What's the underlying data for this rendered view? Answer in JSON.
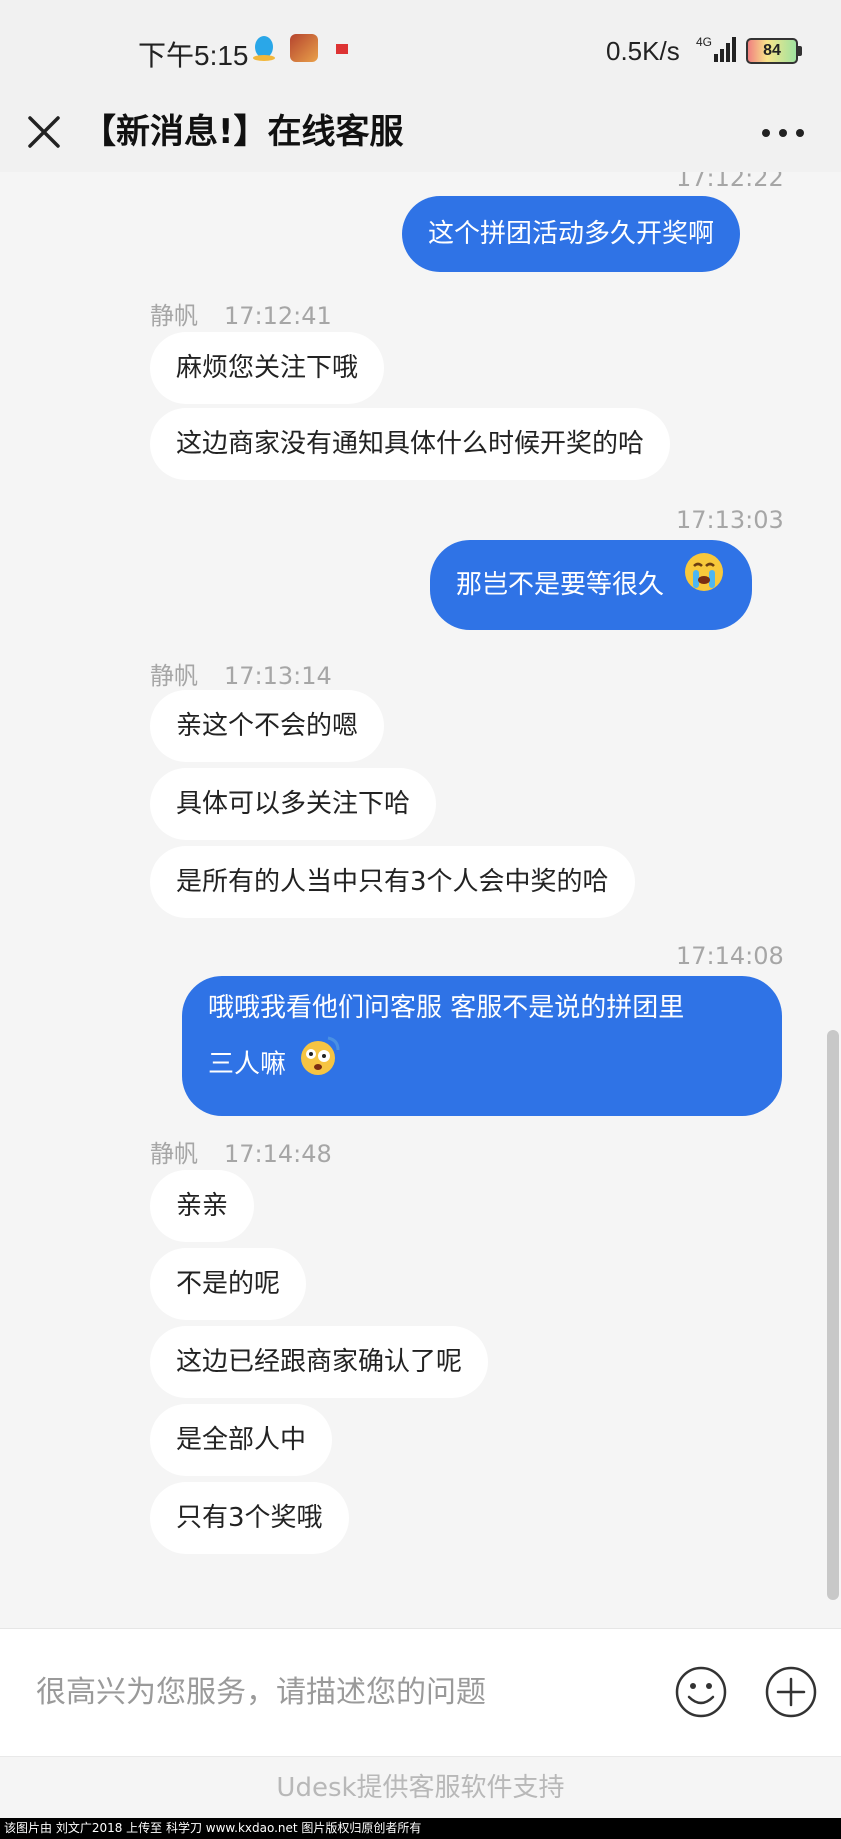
{
  "status_bar": {
    "time": "下午5:15",
    "network_speed": "0.5K/s",
    "network_type": "4G",
    "battery": "84"
  },
  "header": {
    "title": "【新消息!】在线客服",
    "close_icon": "close-icon",
    "more_icon": "more-icon"
  },
  "colors": {
    "outgoing_bubble": "#2f73e6",
    "incoming_bubble": "#ffffff",
    "background": "#f5f5f5"
  },
  "messages": {
    "ts1": "17:12:22",
    "out1": "这个拼团活动多久开奖啊",
    "g1_sender": "静帆",
    "g1_time": "17:12:41",
    "g1_m1": "麻烦您关注下哦",
    "g1_m2": "这边商家没有通知具体什么时候开奖的哈",
    "ts2": "17:13:03",
    "out2": "那岂不是要等很久",
    "g2_sender": "静帆",
    "g2_time": "17:13:14",
    "g2_m1": "亲这个不会的嗯",
    "g2_m2": "具体可以多关注下哈",
    "g2_m3": "是所有的人当中只有3个人会中奖的哈",
    "ts3": "17:14:08",
    "out3_line1": "哦哦我看他们问客服 客服不是说的拼团里",
    "out3_line2": "三人嘛",
    "g3_sender": "静帆",
    "g3_time": "17:14:48",
    "g3_m1": "亲亲",
    "g3_m2": "不是的呢",
    "g3_m3": "这边已经跟商家确认了呢",
    "g3_m4": "是全部人中",
    "g3_m5": "只有3个奖哦"
  },
  "input": {
    "placeholder": "很高兴为您服务，请描述您的问题",
    "smile_icon": "smile-icon",
    "plus_icon": "plus-icon"
  },
  "footer": {
    "text": "Udesk提供客服软件支持"
  },
  "watermark": {
    "text": "该图片由 刘文广2018 上传至 科学刀 www.kxdao.net 图片版权归原创者所有"
  }
}
